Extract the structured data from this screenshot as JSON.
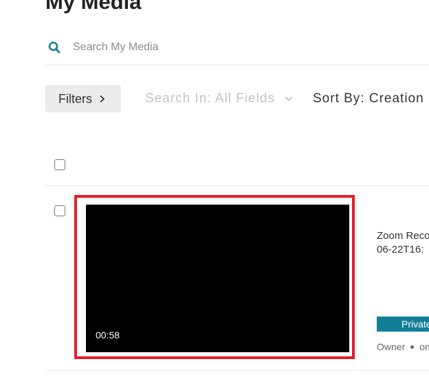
{
  "page": {
    "title": "My Media"
  },
  "search": {
    "placeholder": "Search My Media",
    "value": ""
  },
  "toolbar": {
    "filters_label": "Filters",
    "search_in_label": "Search In: All Fields",
    "sort_by_label": "Sort By: Creation"
  },
  "media_items": [
    {
      "duration": "00:58",
      "title_line1": "Zoom Reco",
      "title_line2": "06-22T16:",
      "privacy_badge": "Private",
      "meta_owner": "Owner",
      "meta_more": "on"
    }
  ],
  "colors": {
    "accent": "#137f97",
    "highlight": "#e41e26",
    "thumbnail_bg": "#000000",
    "filters_bg": "#ebebeb"
  },
  "icons": {
    "search": "search-icon",
    "filters_chevron": "chevron-right-icon",
    "search_in_chevron": "chevron-down-icon"
  }
}
